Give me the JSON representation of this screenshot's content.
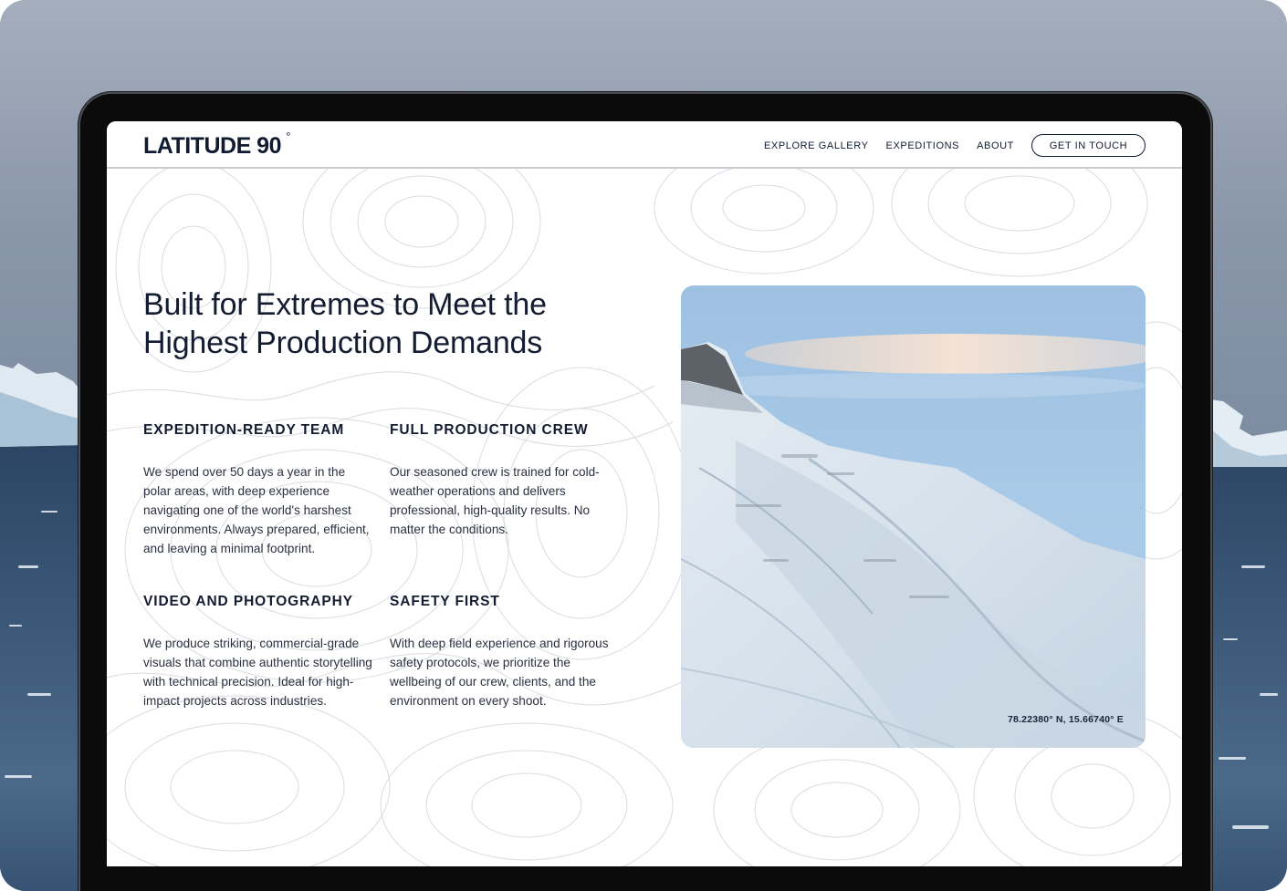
{
  "site": {
    "logo": "LATITUDE 90",
    "logo_degree": "°",
    "nav": {
      "explore_gallery": "EXPLORE GALLERY",
      "expeditions": "EXPEDITIONS",
      "about": "ABOUT",
      "cta": "GET IN TOUCH"
    }
  },
  "hero": {
    "headline_line1": "Built for Extremes to Meet the",
    "headline_line2": "Highest Production Demands"
  },
  "features": [
    {
      "title": "EXPEDITION-READY TEAM",
      "body": "We spend over 50 days a year in the polar areas, with deep experience navigating one of the world's harshest environments. Always prepared, efficient, and leaving a minimal footprint."
    },
    {
      "title": "FULL PRODUCTION CREW",
      "body": "Our seasoned crew is trained for cold-weather operations and delivers professional, high-quality results. No matter the conditions."
    },
    {
      "title": "VIDEO AND PHOTOGRAPHY",
      "body": "We produce striking, commercial-grade visuals that combine authentic storytelling with technical precision. Ideal for high-impact projects across industries."
    },
    {
      "title": "SAFETY FIRST",
      "body": "With deep field experience and rigorous safety protocols, we prioritize the wellbeing of our crew, clients, and the environment on every shoot."
    }
  ],
  "photo": {
    "coordinates": "78.22380° N, 15.66740° E",
    "subject": "snow-covered-mountain"
  },
  "colors": {
    "ink": "#131c30",
    "body_text": "#2b3040",
    "laptop_bezel": "#0b0b0c",
    "sky": "#9aa5b6",
    "sea": "#2f4a68"
  }
}
